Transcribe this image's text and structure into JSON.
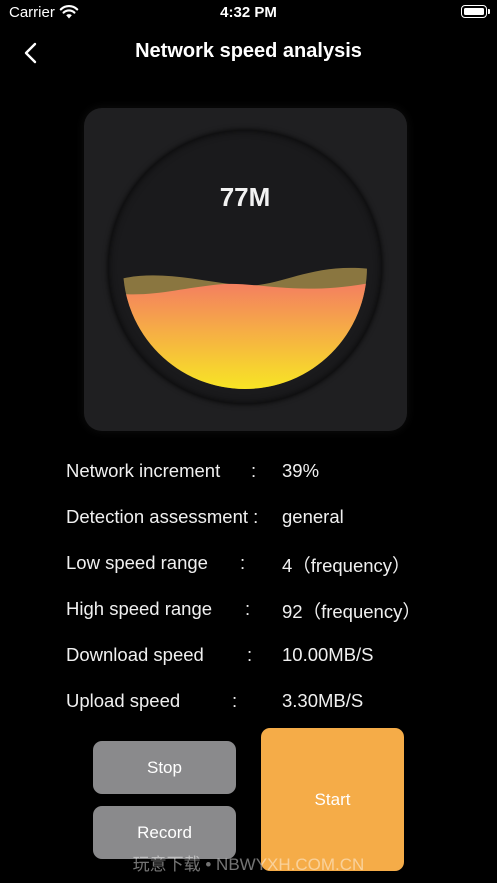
{
  "status_bar": {
    "carrier": "Carrier",
    "time": "4:32 PM"
  },
  "nav": {
    "title": "Network speed analysis"
  },
  "gauge": {
    "speed": "77M",
    "fill_fraction": 0.42,
    "fill_top_color": "#f47c62",
    "fill_bottom_color": "#f8f41c",
    "wave_color": "#8a7640"
  },
  "stats": [
    {
      "label": "Network increment",
      "value": "39%"
    },
    {
      "label": "Detection assessment :",
      "value": "general"
    },
    {
      "label": "Low speed range",
      "value": "4（frequency）"
    },
    {
      "label": "High speed range",
      "value": "92（frequency）"
    },
    {
      "label": "Download speed",
      "value": "10.00MB/S"
    },
    {
      "label": "Upload speed",
      "value": "3.30MB/S"
    }
  ],
  "colon": ":",
  "buttons": {
    "stop": "Stop",
    "record": "Record",
    "start": "Start"
  },
  "watermark": "玩意下载 • NBWYXH.COM.CN"
}
